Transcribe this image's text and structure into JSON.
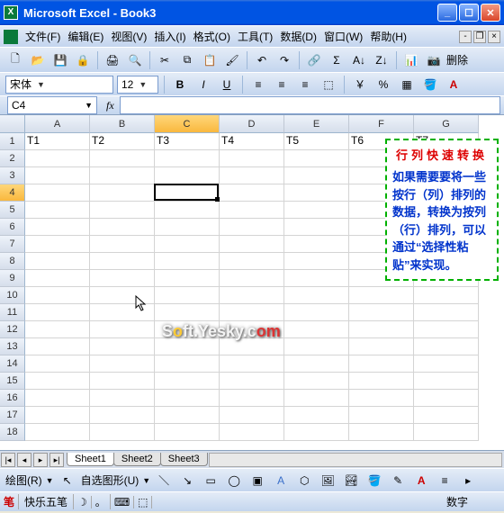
{
  "title": "Microsoft Excel - Book3",
  "menus": [
    "文件(F)",
    "编辑(E)",
    "视图(V)",
    "插入(I)",
    "格式(O)",
    "工具(T)",
    "数据(D)",
    "窗口(W)",
    "帮助(H)"
  ],
  "font_name": "宋体",
  "font_size": "12",
  "namebox": "C4",
  "colheads": [
    "A",
    "B",
    "C",
    "D",
    "E",
    "F",
    "G"
  ],
  "rownums": [
    "1",
    "2",
    "3",
    "4",
    "5",
    "6",
    "7",
    "8",
    "9",
    "10",
    "11",
    "12",
    "13",
    "14",
    "15",
    "16",
    "17",
    "18"
  ],
  "row1": [
    "T1",
    "T2",
    "T3",
    "T4",
    "T5",
    "T6",
    "T7"
  ],
  "active": {
    "col": 2,
    "row": 3
  },
  "tip": {
    "title": "行列快速转换",
    "body": "如果需要要将一些按行（列）排列的数据，转换为按列（行）排列，可以通过“选择性粘贴”来实现。"
  },
  "watermark_text": "Soft.Yesky.com",
  "tabs": [
    "Sheet1",
    "Sheet2",
    "Sheet3"
  ],
  "active_tab": 0,
  "draw_label": "绘图(R)",
  "autoshape": "自选图形(U)",
  "ime_name": "快乐五笔",
  "status_right": "数字",
  "delete_label": "删除"
}
